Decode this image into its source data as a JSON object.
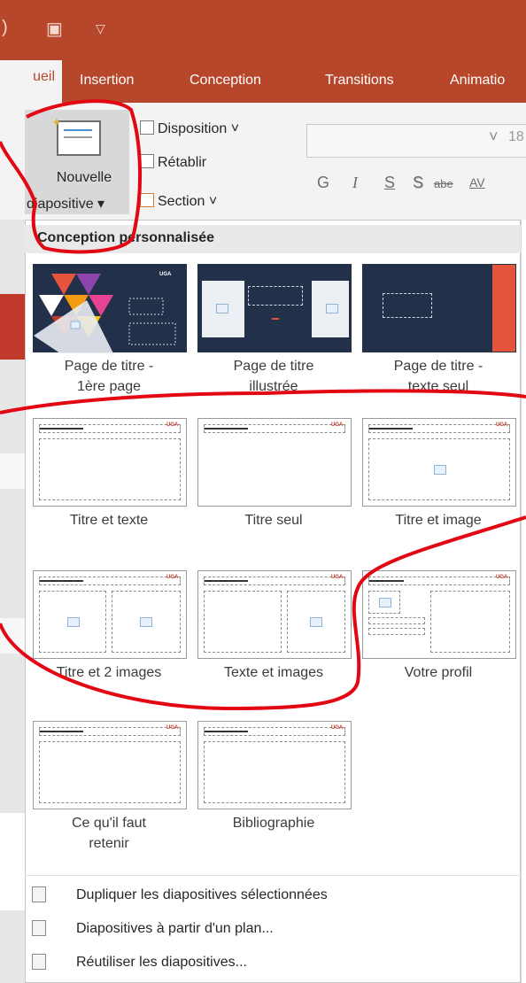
{
  "titlebar": {
    "qa_icon_1": "presenter-icon",
    "qa_icon_2": "dropdown-arrow-icon"
  },
  "tabs": [
    {
      "label": "ueil",
      "active": true
    },
    {
      "label": "Insertion",
      "active": false
    },
    {
      "label": "Conception",
      "active": false
    },
    {
      "label": "Transitions",
      "active": false
    },
    {
      "label": "Animatio",
      "active": false
    }
  ],
  "ribbon": {
    "new_slide_line1": "Nouvelle",
    "new_slide_line2": "diapositive",
    "layout": "Disposition",
    "reset": "Rétablir",
    "section": "Section",
    "font_size": "18",
    "bold": "G",
    "italic": "I",
    "underline": "S",
    "shadow": "S",
    "strike": "abe",
    "spacing": "AV"
  },
  "menu": {
    "header": "Conception personnalisée",
    "layouts": [
      {
        "label_lines": [
          "Page de titre -",
          "1ère page"
        ]
      },
      {
        "label_lines": [
          "Page de titre",
          "illustrée"
        ]
      },
      {
        "label_lines": [
          "Page de titre -",
          "texte seul"
        ]
      },
      {
        "label_lines": [
          "Titre et texte"
        ]
      },
      {
        "label_lines": [
          "Titre seul"
        ]
      },
      {
        "label_lines": [
          "Titre et image"
        ]
      },
      {
        "label_lines": [
          "Titre et 2 images"
        ]
      },
      {
        "label_lines": [
          "Texte et images"
        ]
      },
      {
        "label_lines": [
          "Votre profil"
        ]
      },
      {
        "label_lines": [
          "Ce qu'il faut",
          "retenir"
        ]
      },
      {
        "label_lines": [
          "Bibliographie"
        ]
      }
    ],
    "actions": [
      {
        "label": "Dupliquer les diapositives sélectionnées"
      },
      {
        "label": "Diapositives à partir d'un plan..."
      },
      {
        "label": "Réutiliser les diapositives..."
      }
    ]
  },
  "colors": {
    "accent": "#b7472a",
    "annotation": "#e30613",
    "slide_dark": "#22304a"
  }
}
